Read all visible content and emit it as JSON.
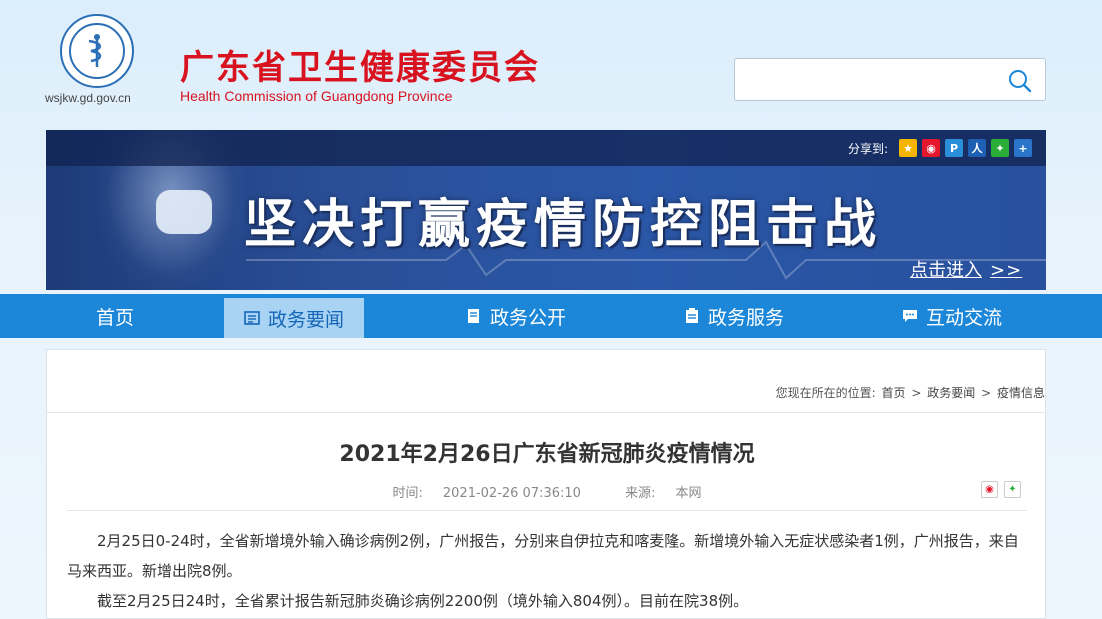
{
  "header": {
    "site_title": "广东省卫生健康委员会",
    "site_subtitle": "Health Commission of Guangdong Province",
    "logo_url_text": "wsjkw.gd.gov.cn",
    "search_placeholder": ""
  },
  "banner": {
    "share_label": "分享到:",
    "share_icons": [
      "qzone-icon",
      "weibo-icon",
      "tencent-icon",
      "people-icon",
      "wechat-icon",
      "more-plus-icon"
    ],
    "slogan": "坚决打赢疫情防控阻击战",
    "link_text": "点击进入",
    "link_arrows": ">>"
  },
  "nav": {
    "items": [
      {
        "label": "首页",
        "icon": ""
      },
      {
        "label": "政务要闻",
        "icon": "news-icon",
        "active": true
      },
      {
        "label": "政务公开",
        "icon": "document-icon"
      },
      {
        "label": "政务服务",
        "icon": "clipboard-icon"
      },
      {
        "label": "互动交流",
        "icon": "chat-icon"
      }
    ]
  },
  "breadcrumb": {
    "prefix": "您现在所在的位置:",
    "items": [
      "首页",
      "政务要闻",
      "疫情信息"
    ],
    "separator": ">"
  },
  "article": {
    "title": "2021年2月26日广东省新冠肺炎疫情情况",
    "time_label": "时间:",
    "time": "2021-02-26 07:36:10",
    "source_label": "来源:",
    "source": "本网",
    "paragraphs": [
      "2月25日0-24时，全省新增境外输入确诊病例2例，广州报告，分别来自伊拉克和喀麦隆。新增境外输入无症状感染者1例，广州报告，来自马来西亚。新增出院8例。",
      "截至2月25日24时，全省累计报告新冠肺炎确诊病例2200例（境外输入804例）。目前在院38例。"
    ]
  },
  "colors": {
    "title_red": "#d8131f",
    "nav_blue": "#1c87d8",
    "nav_active_bg": "#a9d3f3"
  }
}
